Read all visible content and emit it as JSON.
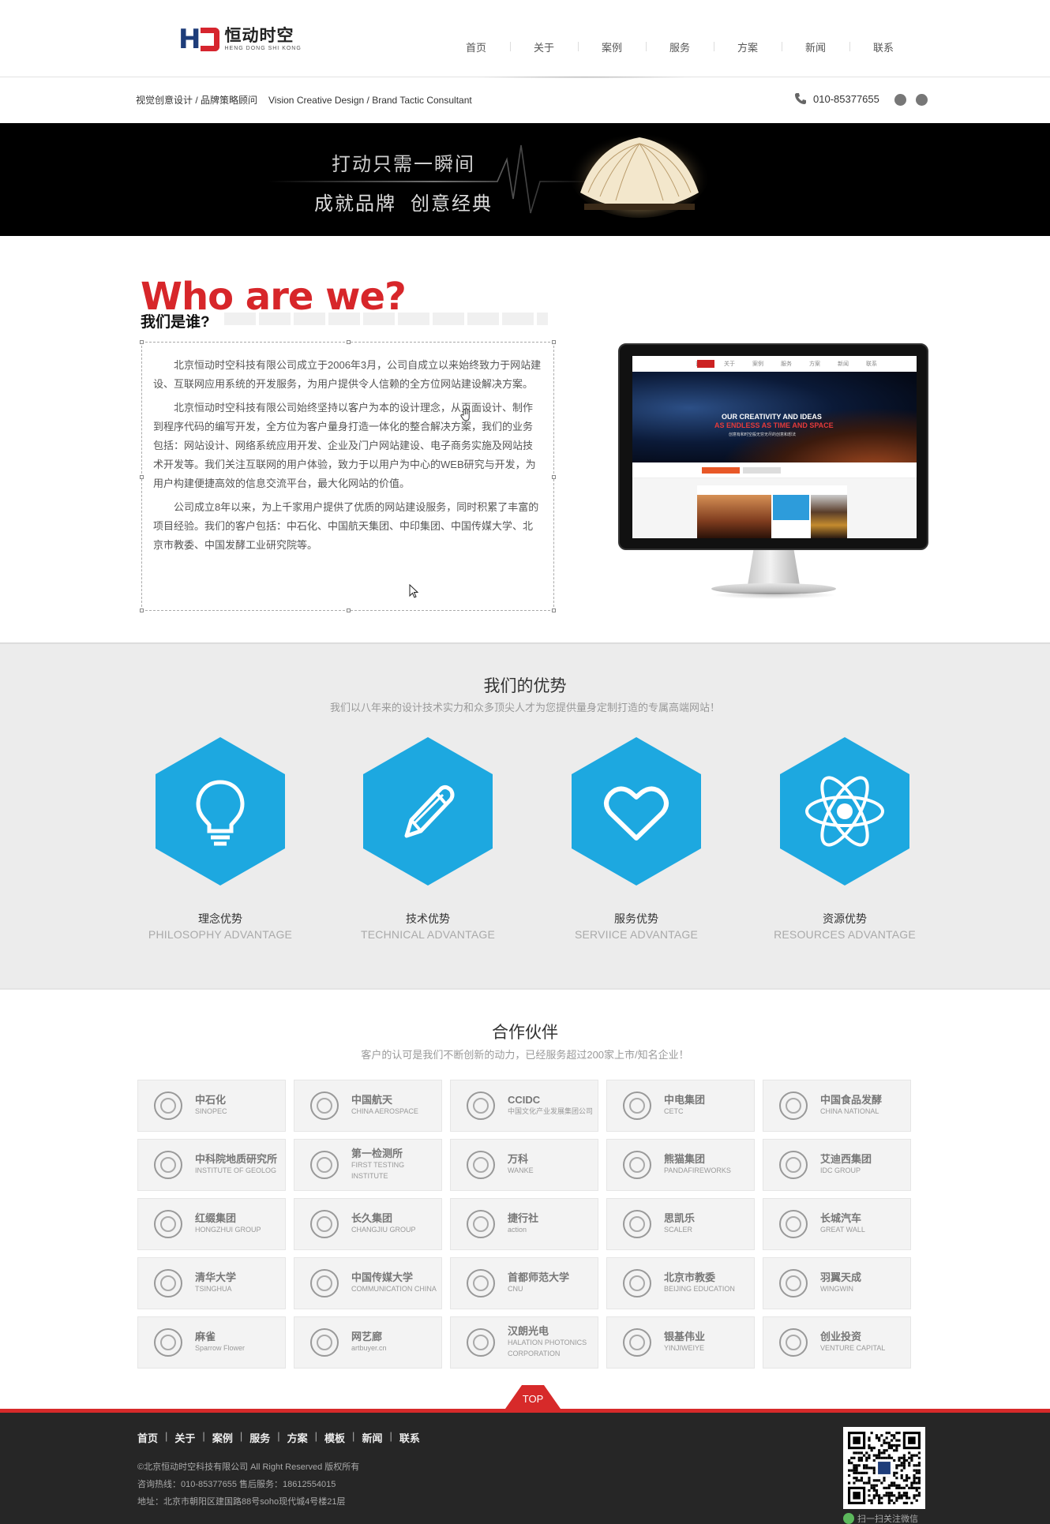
{
  "header": {
    "logo_cn": "恒动时空",
    "logo_en": "HENG DONG SHI KONG",
    "nav": [
      "首页",
      "关于",
      "案例",
      "服务",
      "方案",
      "新闻",
      "联系"
    ]
  },
  "subbar": {
    "slogan_cn": "视觉创意设计 / 品牌策略顾问",
    "slogan_en": "Vision Creative Design / Brand Tactic Consultant",
    "phone": "010-85377655"
  },
  "banner": {
    "line1": "打动只需一瞬间",
    "line2a": "成就品牌",
    "line2b": "创意经典"
  },
  "about": {
    "title": "Who are we?",
    "subtitle": "我们是谁?",
    "paragraphs": [
      "北京恒动时空科技有限公司成立于2006年3月，公司自成立以来始终致力于网站建设、互联网应用系统的开发服务，为用户提供令人信赖的全方位网站建设解决方案。",
      "北京恒动时空科技有限公司始终坚持以客户为本的设计理念，从页面设计、制作到程序代码的编写开发，全方位为客户量身打造一体化的整合解决方案，我们的业务包括：网站设计、网络系统应用开发、企业及门户网站建设、电子商务实施及网站技术开发等。我们关注互联网的用户体验，致力于以用户为中心的WEB研究与开发，为用户构建便捷高效的信息交流平台，最大化网站的价值。",
      "公司成立8年以来，为上千家用户提供了优质的网站建设服务，同时积累了丰富的项目经验。我们的客户包括：中石化、中国航天集团、中印集团、中国传媒大学、北京市教委、中国发酵工业研究院等。"
    ],
    "screen": {
      "line1": "OUR CREATIVITY AND IDEAS",
      "line2": "AS ENDLESS AS TIME AND SPACE",
      "line3": "创意有和时空般无穷无尽的创意和想法"
    }
  },
  "advantages": {
    "title": "我们的优势",
    "subtitle": "我们以八年来的设计技术实力和众多顶尖人才为您提供量身定制打造的专属高端网站！",
    "items": [
      {
        "cn": "理念优势",
        "en": "PHILOSOPHY ADVANTAGE",
        "icon": "lightbulb-icon"
      },
      {
        "cn": "技术优势",
        "en": "TECHNICAL ADVANTAGE",
        "icon": "pencil-icon"
      },
      {
        "cn": "服务优势",
        "en": "SERVIICE ADVANTAGE",
        "icon": "heart-icon"
      },
      {
        "cn": "资源优势",
        "en": "RESOURCES ADVANTAGE",
        "icon": "atom-icon"
      }
    ]
  },
  "partners": {
    "title": "合作伙伴",
    "subtitle": "客户的认可是我们不断创新的动力，已经服务超过200家上市/知名企业！",
    "list": [
      {
        "cn": "中石化",
        "en": "SINOPEC"
      },
      {
        "cn": "中国航天",
        "en": "CHINA AEROSPACE"
      },
      {
        "cn": "CCIDC",
        "en": "中国文化产业发展集团公司"
      },
      {
        "cn": "中电集团",
        "en": "CETC"
      },
      {
        "cn": "中国食品发酵",
        "en": "CHINA NATIONAL"
      },
      {
        "cn": "中科院地质研究所",
        "en": "INSTITUTE OF GEOLOG"
      },
      {
        "cn": "第一检测所",
        "en": "FIRST TESTING INSTITUTE"
      },
      {
        "cn": "万科",
        "en": "WANKE"
      },
      {
        "cn": "熊猫集团",
        "en": "PANDAFIREWORKS"
      },
      {
        "cn": "艾迪西集团",
        "en": "IDC GROUP"
      },
      {
        "cn": "红缀集团",
        "en": "HONGZHUI GROUP"
      },
      {
        "cn": "长久集团",
        "en": "CHANGJIU GROUP"
      },
      {
        "cn": "捷行社",
        "en": "action"
      },
      {
        "cn": "思凯乐",
        "en": "SCALER"
      },
      {
        "cn": "长城汽车",
        "en": "GREAT WALL"
      },
      {
        "cn": "清华大学",
        "en": "TSINGHUA"
      },
      {
        "cn": "中国传媒大学",
        "en": "COMMUNICATION CHINA"
      },
      {
        "cn": "首都师范大学",
        "en": "CNU"
      },
      {
        "cn": "北京市教委",
        "en": "BEIJING EDUCATION"
      },
      {
        "cn": "羽翼天成",
        "en": "WINGWIN"
      },
      {
        "cn": "麻雀",
        "en": "Sparrow Flower"
      },
      {
        "cn": "网艺廊",
        "en": "artbuyer.cn"
      },
      {
        "cn": "汉朗光电",
        "en": "HALATION PHOTONICS CORPORATION"
      },
      {
        "cn": "银基伟业",
        "en": "YINJIWEIYE"
      },
      {
        "cn": "创业投资",
        "en": "VENTURE CAPITAL"
      }
    ]
  },
  "top_label": "TOP",
  "footer": {
    "nav": [
      "首页",
      "关于",
      "案例",
      "服务",
      "方案",
      "模板",
      "新闻",
      "联系"
    ],
    "separator": "|",
    "copyright": "©北京恒动时空科技有限公司 All Right Reserved 版权所有",
    "hotline": "咨询热线：010-85377655 售后服务：18612554015",
    "address": "地址：北京市朝阳区建国路88号soho现代城4号楼21层",
    "qr_caption": "扫一扫关注微信"
  },
  "colors": {
    "brand_red": "#d72a2a",
    "brand_blue": "#1e3d7a",
    "hex_blue": "#1da8e0",
    "footer_bg": "#262626"
  }
}
